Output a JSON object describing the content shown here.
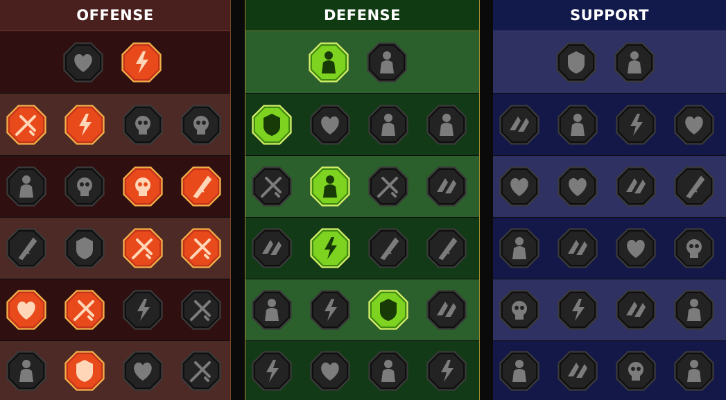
{
  "colors": {
    "offense_active": "#e84a1c",
    "defense_active": "#7ed321",
    "inactive": "#2a2a2a"
  },
  "columns": [
    {
      "title": "OFFENSE",
      "rows": [
        [
          {
            "icon": "crossed-swords-icon",
            "active": false
          },
          {
            "icon": "flaming-sword-icon",
            "active": true
          }
        ],
        [
          {
            "icon": "demon-figure-icon",
            "active": true
          },
          {
            "icon": "slashing-blade-icon",
            "active": true
          },
          {
            "icon": "shield-arrow-icon",
            "active": false
          },
          {
            "icon": "pierced-heart-icon",
            "active": false
          }
        ],
        [
          {
            "icon": "arrow-volley-icon",
            "active": false
          },
          {
            "icon": "fanged-jaws-icon",
            "active": false
          },
          {
            "icon": "skull-slash-icon",
            "active": true
          },
          {
            "icon": "dagger-hand-icon",
            "active": true
          }
        ],
        [
          {
            "icon": "sword-dagger-icon",
            "active": false
          },
          {
            "icon": "fist-strike-icon",
            "active": false
          },
          {
            "icon": "axe-slash-icon",
            "active": true
          },
          {
            "icon": "lightning-chain-icon",
            "active": true
          }
        ],
        [
          {
            "icon": "arrows-target-icon",
            "active": true
          },
          {
            "icon": "triple-skull-icon",
            "active": true
          },
          {
            "icon": "sword-circle-icon",
            "active": false
          },
          {
            "icon": "muscle-warrior-icon",
            "active": false
          }
        ],
        [
          {
            "icon": "sparkle-blade-icon",
            "active": false
          },
          {
            "icon": "flaming-helm-icon",
            "active": true
          },
          {
            "icon": "horned-beast-icon",
            "active": false
          },
          {
            "icon": "spiked-skull-icon",
            "active": false
          }
        ]
      ]
    },
    {
      "title": "DEFENSE",
      "rows": [
        [
          {
            "icon": "stacked-armor-icon",
            "active": true
          },
          {
            "icon": "raised-fist-icon",
            "active": false
          }
        ],
        [
          {
            "icon": "chevron-shield-icon",
            "active": true
          },
          {
            "icon": "anatomical-heart-icon",
            "active": false
          },
          {
            "icon": "armored-body-icon",
            "active": false
          },
          {
            "icon": "crossed-blades-icon",
            "active": false
          }
        ],
        [
          {
            "icon": "archer-figure-icon",
            "active": false
          },
          {
            "icon": "knight-shield-icon",
            "active": true
          },
          {
            "icon": "heart-icon",
            "active": false
          },
          {
            "icon": "hooded-face-icon",
            "active": false
          }
        ],
        [
          {
            "icon": "crowd-figures-icon",
            "active": false
          },
          {
            "icon": "hourglass-icon",
            "active": true
          },
          {
            "icon": "open-hand-icon",
            "active": false
          },
          {
            "icon": "bull-head-icon",
            "active": false
          }
        ],
        [
          {
            "icon": "dashing-figure-icon",
            "active": false
          },
          {
            "icon": "claw-marks-icon",
            "active": false
          },
          {
            "icon": "radiant-skull-icon",
            "active": true
          },
          {
            "icon": "deflect-slash-icon",
            "active": false
          }
        ],
        [
          {
            "icon": "feral-beast-icon",
            "active": false
          },
          {
            "icon": "winged-shield-icon",
            "active": false
          },
          {
            "icon": "cracked-skull-icon",
            "active": false
          },
          {
            "icon": "flexing-figure-icon",
            "active": false
          }
        ]
      ]
    },
    {
      "title": "SUPPORT",
      "rows": [
        [
          {
            "icon": "healing-heart-icon",
            "active": false
          },
          {
            "icon": "swirling-hand-icon",
            "active": false
          }
        ],
        [
          {
            "icon": "praying-hands-icon",
            "active": false
          },
          {
            "icon": "arched-shield-icon",
            "active": false
          },
          {
            "icon": "flaming-skull-icon",
            "active": false
          },
          {
            "icon": "swift-boot-icon",
            "active": false
          }
        ],
        [
          {
            "icon": "magic-figure-icon",
            "active": false
          },
          {
            "icon": "lightning-shield-icon",
            "active": false
          },
          {
            "icon": "lightning-crack-icon",
            "active": false
          },
          {
            "icon": "twin-figures-icon",
            "active": false
          }
        ],
        [
          {
            "icon": "chained-heart-icon",
            "active": false
          },
          {
            "icon": "comet-strike-icon",
            "active": false
          },
          {
            "icon": "open-book-icon",
            "active": false
          },
          {
            "icon": "fierce-eyes-icon",
            "active": false
          }
        ],
        [
          {
            "icon": "compass-star-icon",
            "active": false
          },
          {
            "icon": "speed-boot-icon",
            "active": false
          },
          {
            "icon": "all-seeing-eye-icon",
            "active": false
          },
          {
            "icon": "dancing-figure-icon",
            "active": false
          }
        ],
        [
          {
            "icon": "potion-flask-icon",
            "active": false
          },
          {
            "icon": "grim-skull-icon",
            "active": false
          },
          {
            "icon": "grasping-hand-icon",
            "active": false
          },
          {
            "icon": "eagle-head-icon",
            "active": false
          }
        ]
      ]
    }
  ]
}
